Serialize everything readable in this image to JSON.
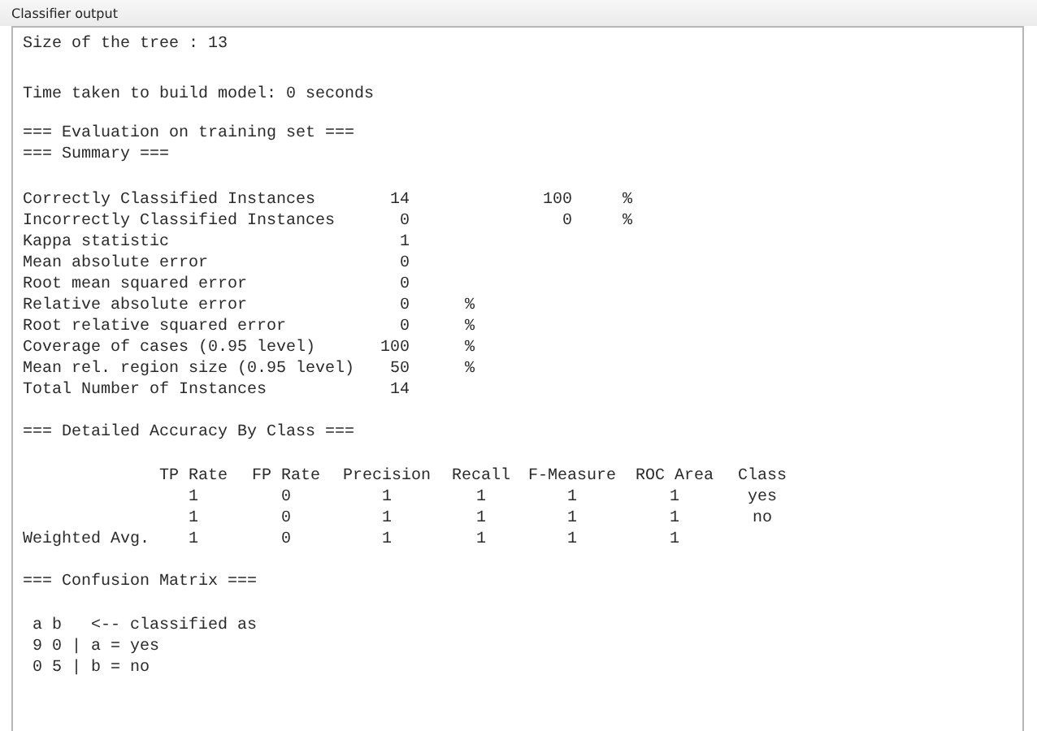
{
  "panel": {
    "title": "Classifier output"
  },
  "header_lines": [
    "Size of the tree : 13",
    "Time taken to build model: 0 seconds"
  ],
  "evaluation": {
    "headings": [
      "=== Evaluation on training set ===",
      "=== Summary ==="
    ],
    "rows": [
      {
        "label": "Correctly Classified Instances",
        "value": "14",
        "percent": "100",
        "percent_unit": "%"
      },
      {
        "label": "Incorrectly Classified Instances",
        "value": "0",
        "percent": "0",
        "percent_unit": "%"
      },
      {
        "label": "Kappa statistic",
        "value": "1"
      },
      {
        "label": "Mean absolute error",
        "value": "0"
      },
      {
        "label": "Root mean squared error",
        "value": "0"
      },
      {
        "label": "Relative absolute error",
        "value": "0",
        "unit": "%"
      },
      {
        "label": "Root relative squared error",
        "value": "0",
        "unit": "%"
      },
      {
        "label": "Coverage of cases (0.95 level)",
        "value": "100",
        "unit": "%"
      },
      {
        "label": "Mean rel. region size (0.95 level)",
        "value": "50",
        "unit": "%"
      },
      {
        "label": "Total Number of Instances",
        "value": "14"
      }
    ]
  },
  "accuracy": {
    "heading": "=== Detailed Accuracy By Class ===",
    "columns": [
      "TP Rate",
      "FP Rate",
      "Precision",
      "Recall",
      "F-Measure",
      "ROC Area",
      "Class"
    ],
    "rows": [
      {
        "label": "",
        "cells": [
          "1",
          "0",
          "1",
          "1",
          "1",
          "1",
          "yes"
        ]
      },
      {
        "label": "",
        "cells": [
          "1",
          "0",
          "1",
          "1",
          "1",
          "1",
          "no"
        ]
      },
      {
        "label": "Weighted Avg.",
        "cells": [
          "1",
          "0",
          "1",
          "1",
          "1",
          "1"
        ]
      }
    ]
  },
  "confusion": {
    "heading": "=== Confusion Matrix ===",
    "lines": [
      "a b   <-- classified as",
      "9 0 | a = yes",
      "0 5 | b = no"
    ]
  }
}
